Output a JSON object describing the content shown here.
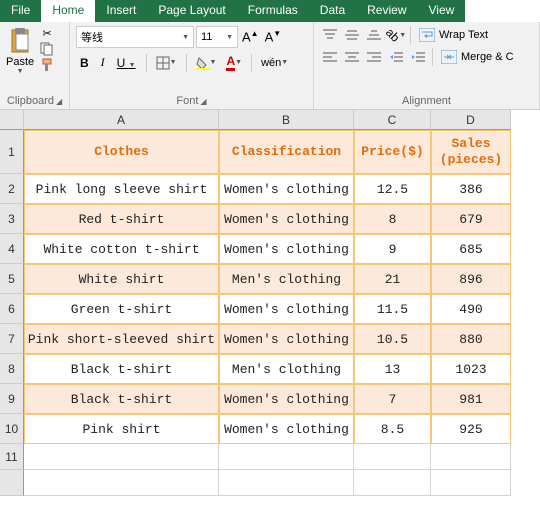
{
  "tabs": {
    "file": "File",
    "home": "Home",
    "insert": "Insert",
    "pagelayout": "Page Layout",
    "formulas": "Formulas",
    "data": "Data",
    "review": "Review",
    "view": "View"
  },
  "ribbon": {
    "paste": "Paste",
    "clipboard": "Clipboard",
    "font_name": "等线",
    "font_size": "11",
    "font_group": "Font",
    "align_group": "Alignment",
    "wrap": "Wrap Text",
    "merge": "Merge & C"
  },
  "cols": [
    "A",
    "B",
    "C",
    "D"
  ],
  "rows": [
    "1",
    "2",
    "3",
    "4",
    "5",
    "6",
    "7",
    "8",
    "9",
    "10",
    "11",
    ""
  ],
  "headers": {
    "a": "Clothes",
    "b": "Classification",
    "c": "Price($)",
    "d1": "Sales",
    "d2": "(pieces)"
  },
  "chart_data": {
    "type": "table",
    "title": "",
    "columns": [
      "Clothes",
      "Classification",
      "Price($)",
      "Sales (pieces)"
    ],
    "rows": [
      {
        "clothes": "Pink long sleeve shirt",
        "classification": "Women's clothing",
        "price": 12.5,
        "sales": 386
      },
      {
        "clothes": "Red t-shirt",
        "classification": "Women's clothing",
        "price": 8,
        "sales": 679
      },
      {
        "clothes": "White cotton t-shirt",
        "classification": "Women's clothing",
        "price": 9,
        "sales": 685
      },
      {
        "clothes": "White shirt",
        "classification": "Men's clothing",
        "price": 21,
        "sales": 896
      },
      {
        "clothes": "Green t-shirt",
        "classification": "Women's clothing",
        "price": 11.5,
        "sales": 490
      },
      {
        "clothes": "Pink short-sleeved shirt",
        "classification": "Women's clothing",
        "price": 10.5,
        "sales": 880
      },
      {
        "clothes": "Black t-shirt",
        "classification": "Men's clothing",
        "price": 13,
        "sales": 1023
      },
      {
        "clothes": "Black t-shirt",
        "classification": "Women's clothing",
        "price": 7,
        "sales": 981
      },
      {
        "clothes": "Pink shirt",
        "classification": "Women's clothing",
        "price": 8.5,
        "sales": 925
      }
    ]
  }
}
